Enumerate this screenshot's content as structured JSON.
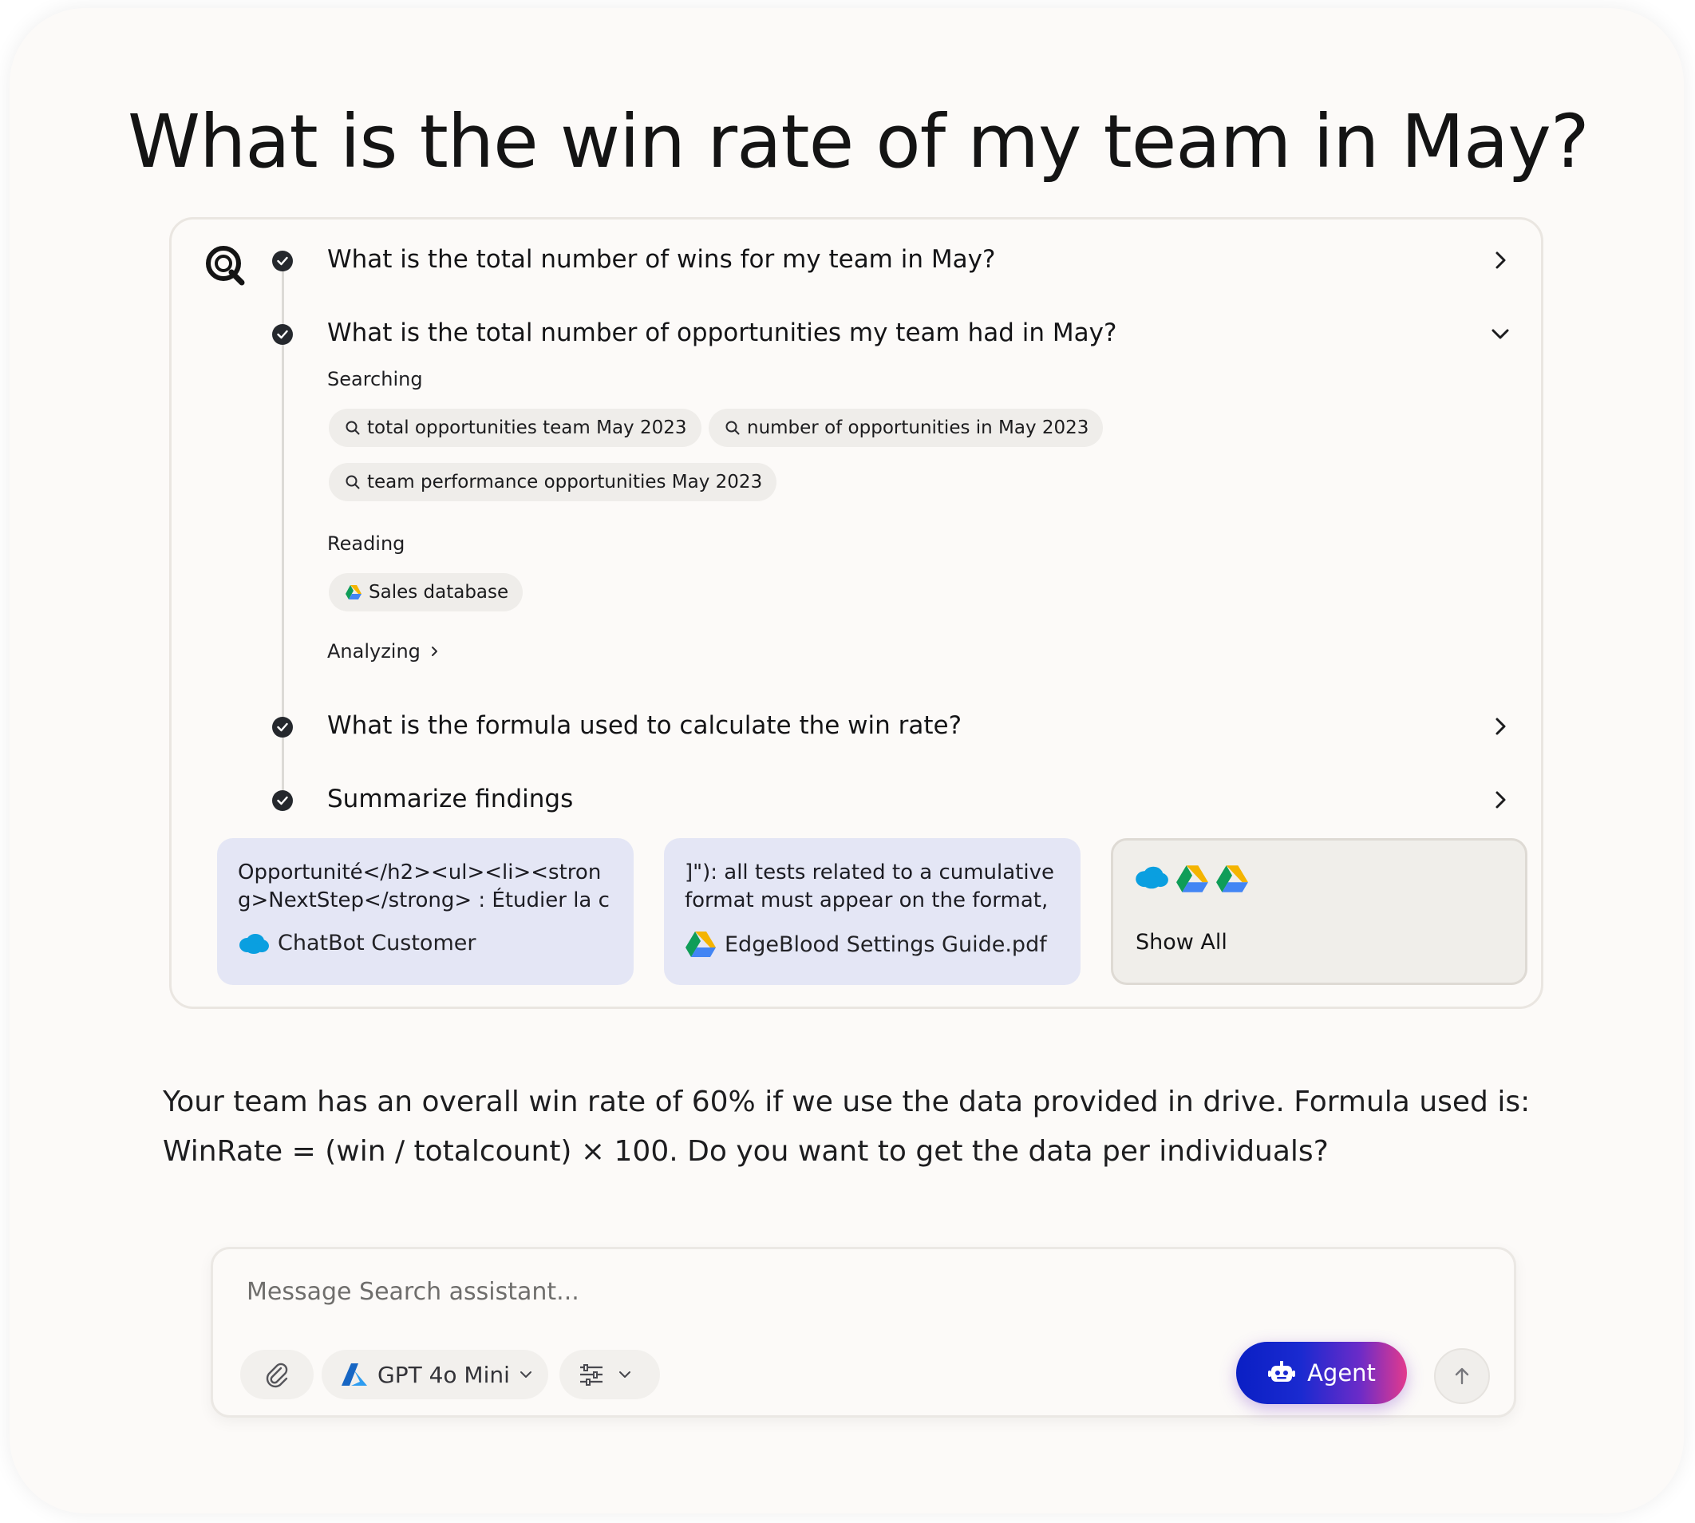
{
  "title": "What is the win rate of my team in May?",
  "steps": [
    {
      "label": "What is the total number of wins for my team in May?",
      "expanded": false
    },
    {
      "label": "What is the total number of opportunities my team had in May?",
      "expanded": true
    },
    {
      "label": "What is the formula used to calculate the win rate?",
      "expanded": false
    },
    {
      "label": "Summarize findings",
      "expanded": false
    }
  ],
  "expanded_step": {
    "searching_label": "Searching",
    "search_queries": [
      "total opportunities team May 2023",
      "number of opportunities in May 2023",
      "team performance opportunities May 2023"
    ],
    "reading_label": "Reading",
    "reading_sources": [
      "Sales database"
    ],
    "analyzing_label": "Analyzing"
  },
  "sources": [
    {
      "snippet": "Opportunité</h2><ul><li><strong>NextStep</strong> : Étudier la candida...",
      "name": "ChatBot Customer",
      "icon": "salesforce-icon"
    },
    {
      "snippet": "]\"): all tests related to a cumulative format must appear on the format, all...",
      "name": "EdgeBlood Settings Guide.pdf",
      "icon": "google-drive-icon"
    }
  ],
  "show_all": {
    "label": "Show All",
    "icons": [
      "salesforce-icon",
      "google-drive-icon",
      "google-drive-icon"
    ]
  },
  "answer": "Your team has an overall win rate of 60% if we use the data provided in drive. Formula used is: WinRate = (win / totalcount) × 100. Do you want to get the data per individuals?",
  "composer": {
    "placeholder": "Message Search assistant...",
    "model": "GPT 4o Mini",
    "agent_label": "Agent"
  },
  "colors": {
    "agent_gradient_start": "#0a1fc4",
    "agent_gradient_end": "#e33a8d",
    "source_card_bg": "#e4e6f5",
    "step_dot": "#25282d"
  }
}
